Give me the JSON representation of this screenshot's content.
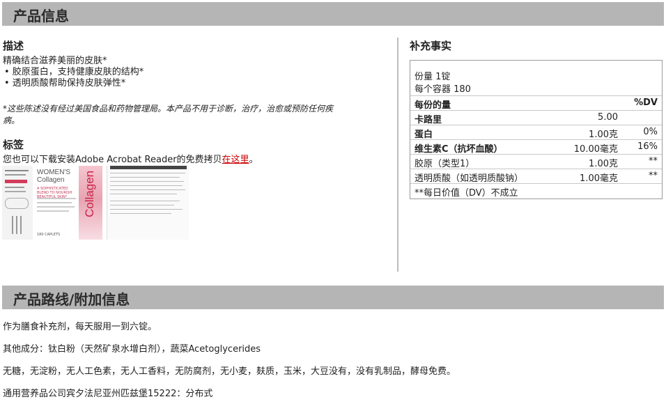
{
  "sections": {
    "product_info_title": "产品信息",
    "route_title": "产品路线/附加信息"
  },
  "description": {
    "heading": "描述",
    "intro": "精确结合滋养美丽的皮肤*",
    "bullets": [
      "• 胶原蛋白，支持健康皮肤的结构*",
      "• 透明质酸帮助保持皮肤弹性*"
    ],
    "disclaimer_line1": "*这些陈述没有经过美国食品和药物管理局。本产品不用于诊断，治疗，治愈或预防任何疾",
    "disclaimer_line2": "病。"
  },
  "label": {
    "heading": "标签",
    "download_text": "您也可以下载安装Adobe Acrobat Reader的免费拷贝",
    "download_link": "在这里",
    "download_end": "。",
    "image": {
      "brand_line1": "WOMEN'S",
      "brand_line2": "Collagen",
      "vertical_word": "Collagen",
      "tagline": "A SOPHISTICATED BLEND TO NOURISH BEAUTIFUL SKIN*",
      "count": "180 CAPLETS"
    }
  },
  "supplement_facts": {
    "heading": "补充事实",
    "serving_size": "份量 1锭",
    "servings_per_container": "每个容器 180",
    "per_serving_header": "每份的量",
    "dv_header": "%DV",
    "rows": [
      {
        "name": "卡路里",
        "amount": "5.00",
        "dv": "",
        "bold": true
      },
      {
        "name": "蛋白",
        "amount": "1.00克",
        "dv": "0%",
        "bold": true
      },
      {
        "name": "维生素C（抗坏血酸）",
        "amount": "10.00毫克",
        "dv": "16%",
        "bold": true
      },
      {
        "name": "胶原（类型1）",
        "amount": "1.00克",
        "dv": "**",
        "bold": false
      },
      {
        "name": "透明质酸（如透明质酸钠）",
        "amount": "1.00毫克",
        "dv": "**",
        "bold": false
      }
    ],
    "footnote": "**每日价值（DV）不成立"
  },
  "additional": {
    "usage": "作为膳食补充剂，每天服用一到六锭。",
    "other_ingredients": "其他成分：钛白粉（天然矿泉水增白剂），蔬菜Acetoglycerides",
    "free_from": "无糖，无淀粉，无人工色素，无人工香料，无防腐剂，无小麦，麸质，玉米，大豆没有，没有乳制品，酵母免费。",
    "distributor": "通用营养品公司宾夕法尼亚州匹兹堡15222：分布式"
  },
  "colors": {
    "section_bar": "#b5b5b5",
    "link": "#cc0000",
    "divider": "#bcbcbc"
  }
}
